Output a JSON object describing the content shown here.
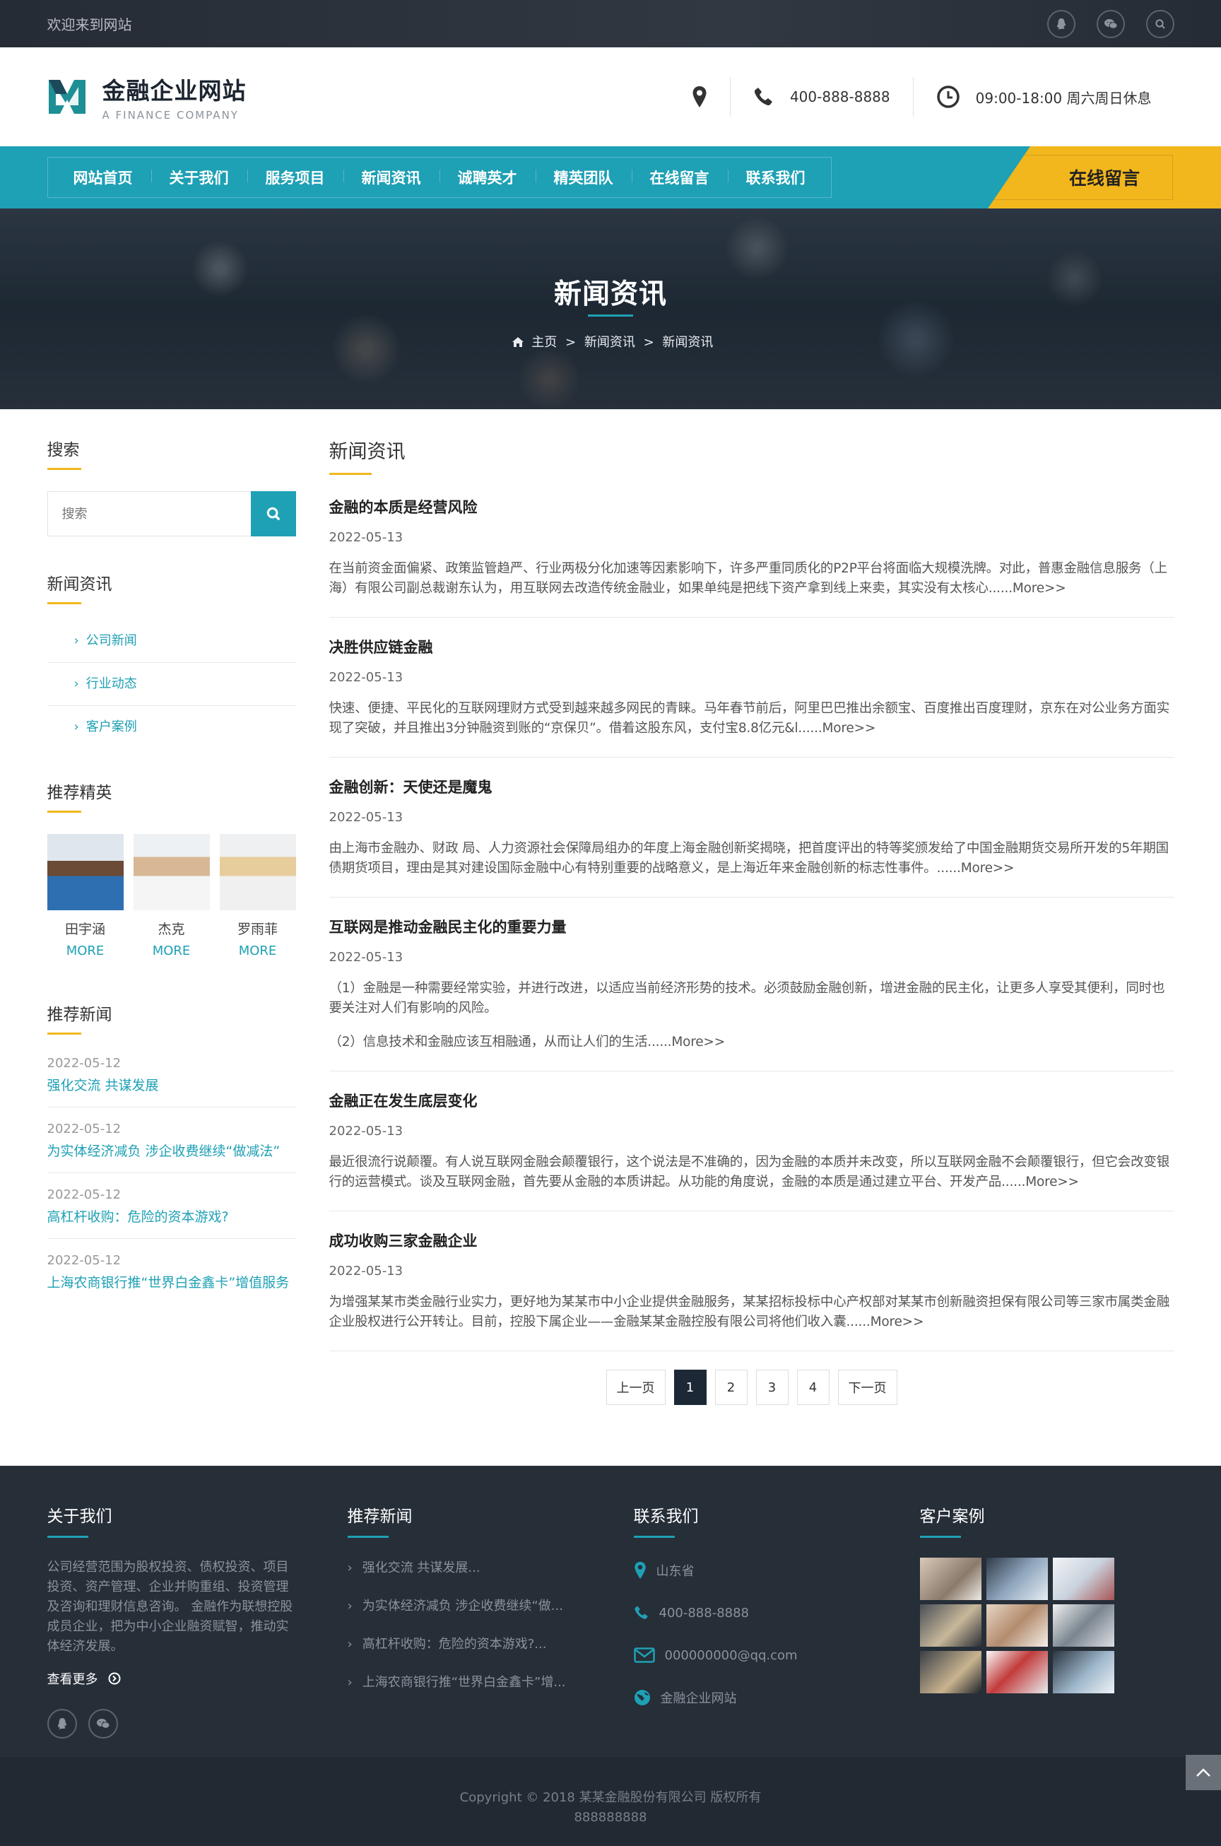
{
  "topbar": {
    "welcome": "欢迎来到网站",
    "icons": [
      "qq-icon",
      "wechat-icon",
      "search-icon"
    ]
  },
  "header": {
    "logo_cn": "金融企业网站",
    "logo_en": "A FINANCE COMPANY",
    "phone": "400-888-8888",
    "hours": "09:00-18:00 周六周日休息"
  },
  "nav": {
    "items": [
      "网站首页",
      "关于我们",
      "服务项目",
      "新闻资讯",
      "诚聘英才",
      "精英团队",
      "在线留言",
      "联系我们"
    ],
    "cta": "在线留言",
    "colors": {
      "accent": "#1ea0b5",
      "cta": "#f2b71d"
    }
  },
  "banner": {
    "title": "新闻资讯",
    "crumb_home": "主页",
    "crumb_sep": ">",
    "crumb_section": "新闻资讯",
    "crumb_current": "新闻资讯"
  },
  "sidebar": {
    "search_title": "搜索",
    "search_placeholder": "搜索",
    "news_title": "新闻资讯",
    "categories": [
      "公司新闻",
      "行业动态",
      "客户案例"
    ],
    "elite_title": "推荐精英",
    "elites": [
      {
        "name": "田宇涵",
        "more": "MORE"
      },
      {
        "name": "杰克",
        "more": "MORE"
      },
      {
        "name": "罗雨菲",
        "more": "MORE"
      }
    ],
    "rec_title": "推荐新闻",
    "rec_news": [
      {
        "date": "2022-05-12",
        "title": "强化交流 共谋发展"
      },
      {
        "date": "2022-05-12",
        "title": "为实体经济减负 涉企收费继续“做减法”"
      },
      {
        "date": "2022-05-12",
        "title": "高杠杆收购：危险的资本游戏?"
      },
      {
        "date": "2022-05-12",
        "title": "上海农商银行推“世界白金鑫卡”增值服务"
      }
    ]
  },
  "content": {
    "title": "新闻资讯",
    "articles": [
      {
        "title": "金融的本质是经营风险",
        "date": "2022-05-13",
        "body": [
          "在当前资金面偏紧、政策监管趋严、行业两极分化加速等因素影响下，许多严重同质化的P2P平台将面临大规模洗牌。对此，普惠金融信息服务（上海）有限公司副总裁谢东认为，用互联网去改造传统金融业，如果单纯是把线下资产拿到线上来卖，其实没有太核心......More>>"
        ]
      },
      {
        "title": "决胜供应链金融",
        "date": "2022-05-13",
        "body": [
          "快速、便捷、平民化的互联网理财方式受到越来越多网民的青睐。马年春节前后，阿里巴巴推出余额宝、百度推出百度理财，京东在对公业务方面实现了突破，并且推出3分钟融资到账的“京保贝”。借着这股东风，支付宝8.8亿元&l......More>>"
        ]
      },
      {
        "title": "金融创新：天使还是魔鬼",
        "date": "2022-05-13",
        "body": [
          "由上海市金融办、财政 局、人力资源社会保障局组办的年度上海金融创新奖揭晓，把首度评出的特等奖颁发给了中国金融期货交易所开发的5年期国债期货项目，理由是其对建设国际金融中心有特别重要的战略意义，是上海近年来金融创新的标志性事件。......More>>"
        ]
      },
      {
        "title": "互联网是推动金融民主化的重要力量",
        "date": "2022-05-13",
        "body": [
          "（1）金融是一种需要经常实验，并进行改进，以适应当前经济形势的技术。必须鼓励金融创新，增进金融的民主化，让更多人享受其便利，同时也要关注对人们有影响的风险。",
          "（2）信息技术和金融应该互相融通，从而让人们的生活......More>>"
        ]
      },
      {
        "title": "金融正在发生底层变化",
        "date": "2022-05-13",
        "body": [
          "最近很流行说颠覆。有人说互联网金融会颠覆银行，这个说法是不准确的，因为金融的本质并未改变，所以互联网金融不会颠覆银行，但它会改变银行的运营模式。谈及互联网金融，首先要从金融的本质讲起。从功能的角度说，金融的本质是通过建立平台、开发产品......More>>"
        ]
      },
      {
        "title": "成功收购三家金融企业",
        "date": "2022-05-13",
        "body": [
          "为增强某某市类金融行业实力，更好地为某某市中小企业提供金融服务，某某招标投标中心产权部对某某市创新融资担保有限公司等三家市属类金融企业股权进行公开转让。目前，控股下属企业——金融某某金融控股有限公司将他们收入囊......More>>"
        ]
      }
    ],
    "pager": {
      "prev": "上一页",
      "pages": [
        "1",
        "2",
        "3",
        "4"
      ],
      "current": "1",
      "next": "下一页"
    }
  },
  "footer": {
    "about_title": "关于我们",
    "about_text": "公司经营范围为股权投资、债权投资、项目投资、资产管理、企业并购重组、投资管理及咨询和理财信息咨询。 金融作为联想控股成员企业，把为中小企业融资赋智，推动实体经济发展。",
    "about_more": "查看更多",
    "news_title": "推荐新闻",
    "news": [
      "强化交流 共谋发展...",
      "为实体经济减负 涉企收费继续“做...",
      "高杠杆收购：危险的资本游戏?...",
      "上海农商银行推“世界白金鑫卡”增..."
    ],
    "contact_title": "联系我们",
    "address": "山东省",
    "phone": "400-888-8888",
    "email": "000000000@qq.com",
    "site": "金融企业网站",
    "cases_title": "客户案例",
    "copyright_line1": "Copyright © 2018 某某金融股份有限公司 版权所有",
    "copyright_line2": "888888888"
  }
}
